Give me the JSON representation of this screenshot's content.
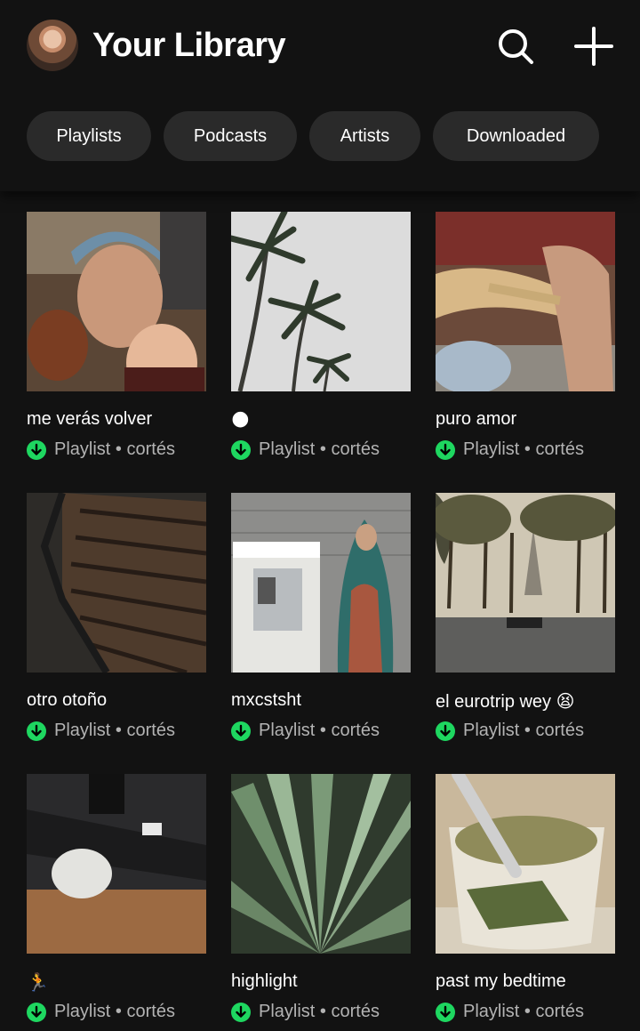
{
  "header": {
    "title": "Your Library"
  },
  "filters": [
    "Playlists",
    "Podcasts",
    "Artists",
    "Downloaded"
  ],
  "colors": {
    "background": "#121212",
    "chip": "#2a2a2a",
    "accent": "#1ed760",
    "secondary_text": "#b3b3b3"
  },
  "icons": {
    "search": "search-icon",
    "add": "plus-icon",
    "download": "downloaded-icon"
  },
  "playlists": [
    {
      "title": "me verás volver",
      "type": "Playlist",
      "owner": "cortés"
    },
    {
      "title": "",
      "emoji": "🌑",
      "type": "Playlist",
      "owner": "cortés"
    },
    {
      "title": "puro amor",
      "type": "Playlist",
      "owner": "cortés"
    },
    {
      "title": "otro otoño",
      "type": "Playlist",
      "owner": "cortés"
    },
    {
      "title": "mxcstsht",
      "type": "Playlist",
      "owner": "cortés"
    },
    {
      "title": "el eurotrip wey",
      "emoji": "😫",
      "type": "Playlist",
      "owner": "cortés"
    },
    {
      "title": "",
      "emoji": "🏃",
      "type": "Playlist",
      "owner": "cortés"
    },
    {
      "title": "highlight",
      "type": "Playlist",
      "owner": "cortés"
    },
    {
      "title": "past my bedtime",
      "type": "Playlist",
      "owner": "cortés"
    }
  ]
}
